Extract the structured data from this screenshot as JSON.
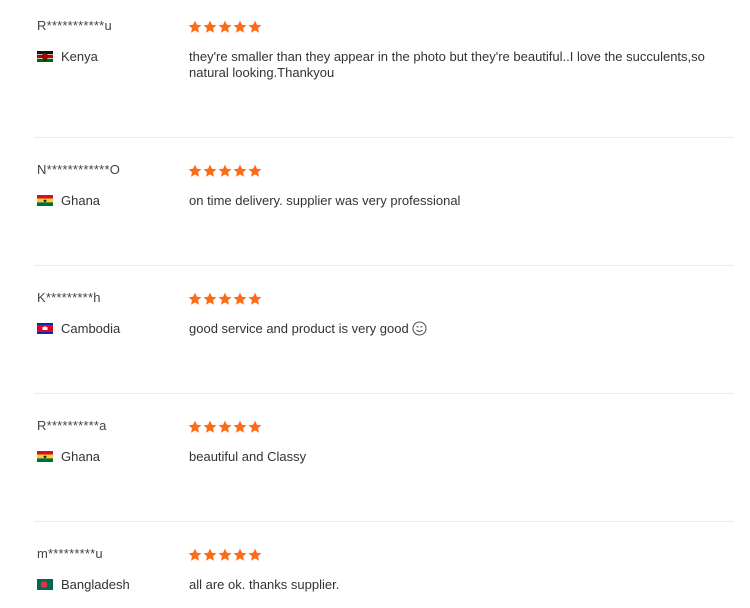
{
  "colors": {
    "star": "#ff6a14",
    "divider": "#ececec"
  },
  "reviews": [
    {
      "user": "R***********u",
      "country": "Kenya",
      "flag": "kenya-flag-icon",
      "rating": 5,
      "text": "they're smaller than they appear in the photo but they're beautiful..I love the succulents,so natural looking.Thankyou"
    },
    {
      "user": "N************O",
      "country": "Ghana",
      "flag": "ghana-flag-icon",
      "rating": 5,
      "text": "on time delivery. supplier was very professional"
    },
    {
      "user": "K*********h",
      "country": "Cambodia",
      "flag": "cambodia-flag-icon",
      "rating": 5,
      "text": "good service and product is very good",
      "emoji": "smiley-icon"
    },
    {
      "user": "R**********a",
      "country": "Ghana",
      "flag": "ghana-flag-icon",
      "rating": 5,
      "text": "beautiful and Classy"
    },
    {
      "user": "m*********u",
      "country": "Bangladesh",
      "flag": "bangladesh-flag-icon",
      "rating": 5,
      "text": "all are ok. thanks supplier."
    }
  ]
}
